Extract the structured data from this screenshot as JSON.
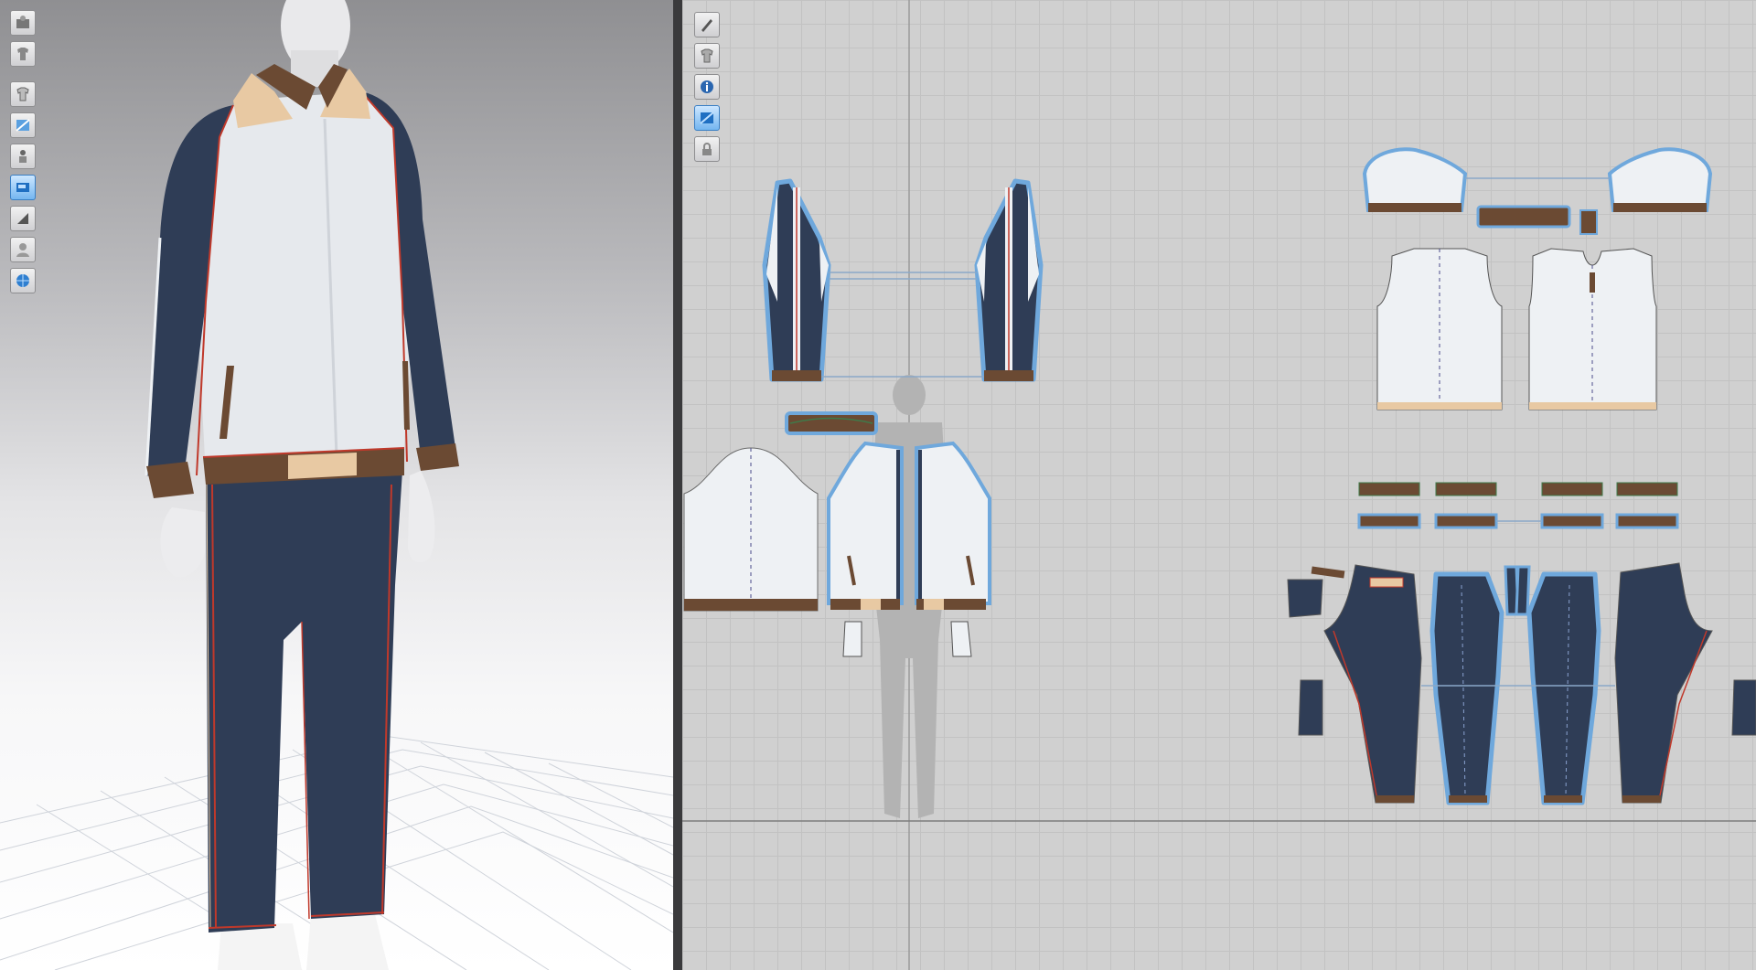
{
  "app": {
    "accent_color": "#3a8ee6",
    "navy_fabric": "#2f3d56",
    "white_fabric": "#eef1f4",
    "trim_brown": "#6b4a33",
    "trim_tan": "#e8c9a3",
    "stitch_red": "#c0392b",
    "outline_blue": "#6fa8dc"
  },
  "viewport_3d": {
    "toolbar": [
      {
        "icon": "avatar-display-icon"
      },
      {
        "icon": "garment-display-icon"
      },
      {
        "icon": "garment-show-icon"
      },
      {
        "icon": "fabric-texture-icon"
      },
      {
        "icon": "avatar-show-icon"
      },
      {
        "icon": "view-2d-3d-icon",
        "active": true
      },
      {
        "icon": "shading-icon"
      },
      {
        "icon": "avatar-silhouette-icon"
      },
      {
        "icon": "environment-globe-icon"
      }
    ]
  },
  "viewport_2d": {
    "toolbar": [
      {
        "icon": "pattern-pen-icon"
      },
      {
        "icon": "pattern-garment-icon"
      },
      {
        "icon": "pattern-info-icon"
      },
      {
        "icon": "pattern-texture-icon",
        "active": true
      },
      {
        "icon": "lock-garment-icon"
      }
    ]
  }
}
